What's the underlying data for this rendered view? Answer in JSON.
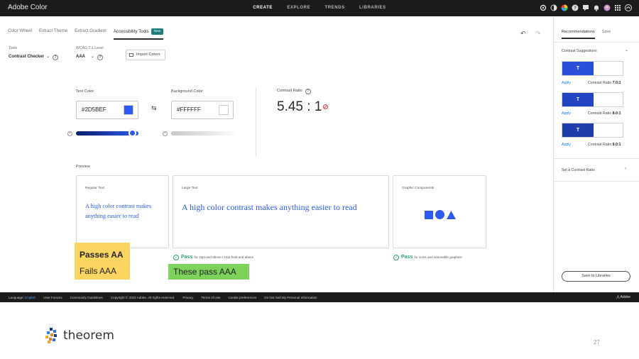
{
  "app": {
    "title": "Adobe Color"
  },
  "topnav": {
    "items": [
      "CREATE",
      "EXPLORE",
      "TRENDS",
      "LIBRARIES"
    ],
    "active": "CREATE"
  },
  "tabs": {
    "items": [
      "Color Wheel",
      "Extract Theme",
      "Extract Gradient",
      "Accessibility Tools"
    ],
    "active": "Accessibility Tools",
    "new_badge": "New"
  },
  "tools": {
    "label": "Tools",
    "value": "Contrast Checker"
  },
  "wcag": {
    "label": "WCAG 2.1 Level",
    "value": "AAA"
  },
  "import_colors": "Import Colors",
  "text_color": {
    "label": "Text Color",
    "hex": "#2D5BEF",
    "color": "#2d5bef",
    "lightness": 0.9
  },
  "background_color": {
    "label": "Background Color",
    "hex": "#FFFFFF",
    "color": "#ffffff",
    "lightness": 0.95
  },
  "contrast_ratio": {
    "label": "Contrast Ratio",
    "value": "5.45 : 1"
  },
  "preview": {
    "label": "Preview",
    "cards": [
      {
        "title": "Regular Text",
        "text": "A high color contrast makes anything easier to read"
      },
      {
        "title": "Large Text",
        "text": "A high color contrast makes anything easier to read"
      },
      {
        "title": "Graphic Components",
        "shapes": [
          "square",
          "circle",
          "triangle"
        ]
      }
    ]
  },
  "results": {
    "large_text": {
      "status": "Pass",
      "note": "for 18pt and above / 14pt bold and above"
    },
    "graphics": {
      "status": "Pass",
      "note": "for icons and actionable graphics"
    }
  },
  "callouts": {
    "yellow_line1": "Passes AA",
    "yellow_line2": "Fails AAA",
    "green_line1": "These pass AAA"
  },
  "right_panel": {
    "tabs": [
      "Recommendations",
      "Save"
    ],
    "active_tab": "Recommendations",
    "suggestions_label": "Contrast Suggestions",
    "suggestions": [
      {
        "glyph": "T",
        "apply": "Apply",
        "ratio_label": "Contrast Ratio",
        "ratio": "7.0:1",
        "color": "#2a4fd8"
      },
      {
        "glyph": "T",
        "apply": "Apply",
        "ratio_label": "Contrast Ratio",
        "ratio": "8.0:1",
        "color": "#2344c0"
      },
      {
        "glyph": "T",
        "apply": "Apply",
        "ratio_label": "Contrast Ratio",
        "ratio": "9.0:1",
        "color": "#1f3ca8"
      }
    ],
    "set_ratio": "Set a Contrast Ratio",
    "save_button": "Save to Libraries"
  },
  "footer": {
    "language_label": "Language:",
    "language_value": "English",
    "links": [
      "User Forums",
      "Community Guidelines",
      "Copyright © 2022 Adobe. All rights reserved.",
      "Privacy",
      "Terms of Use",
      "Cookie preferences",
      "Do Not Sell My Personal Information"
    ],
    "brand": "Adobe"
  },
  "slide": {
    "logo_text": "theorem",
    "page_number": "27"
  }
}
